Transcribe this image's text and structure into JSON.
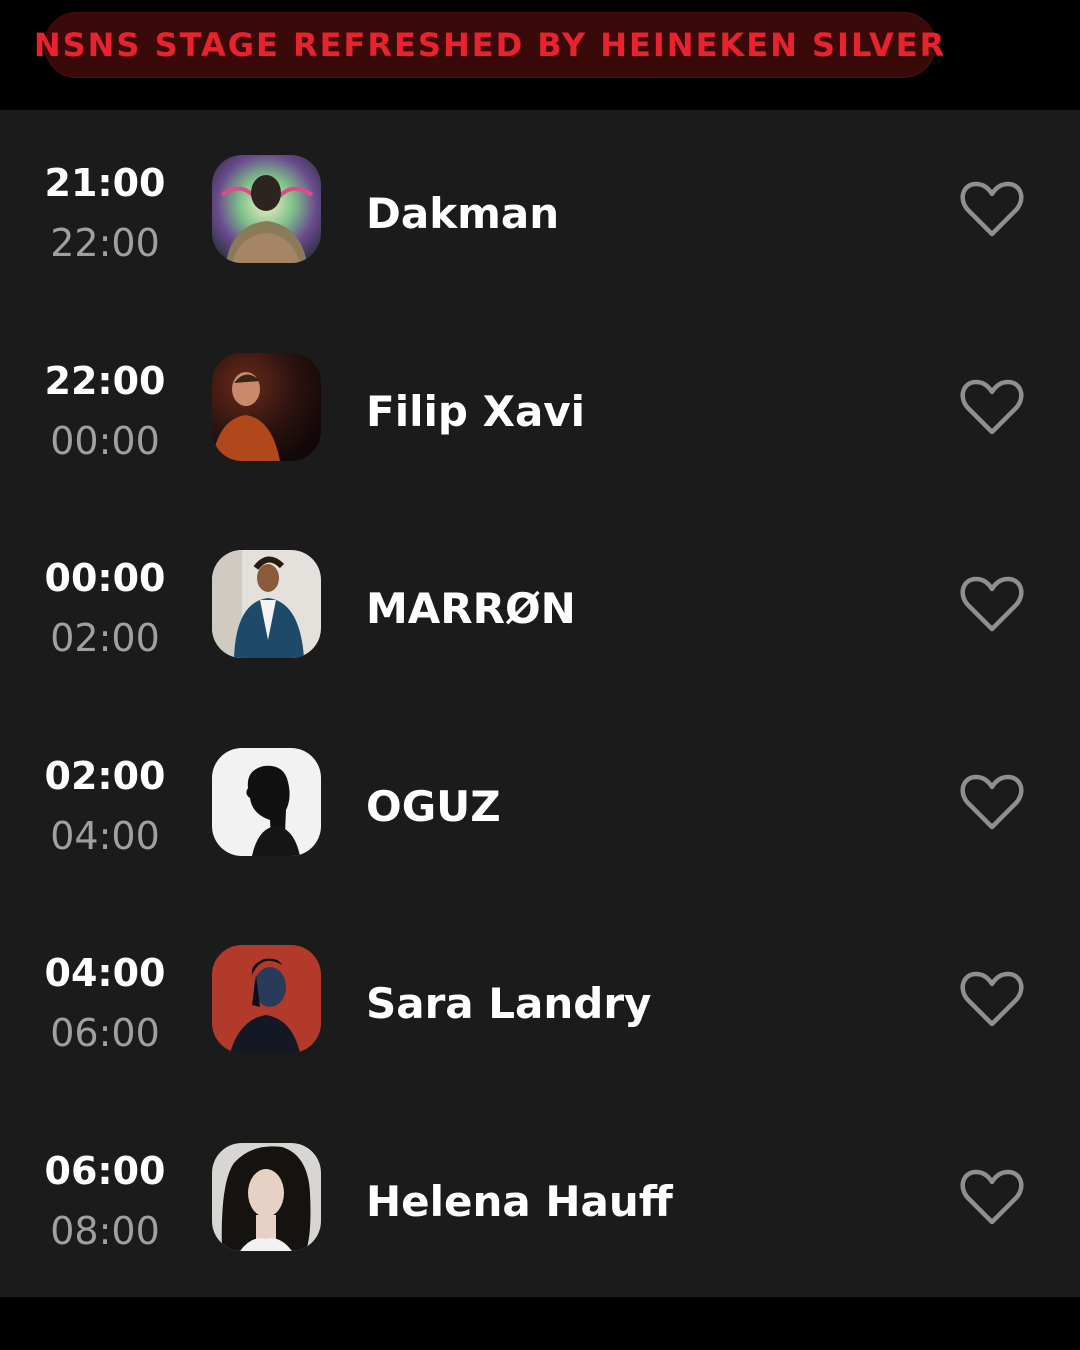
{
  "stage": {
    "title": "NSNS STAGE REFRESHED BY HEINEKEN SILVER",
    "accent_color": "#e8232e",
    "pill_color": "#3a0a0a"
  },
  "lineup": [
    {
      "start": "21:00",
      "end": "22:00",
      "artist": "Dakman",
      "favorite_icon": "heart-outline-icon"
    },
    {
      "start": "22:00",
      "end": "00:00",
      "artist": "Filip Xavi",
      "favorite_icon": "heart-outline-icon"
    },
    {
      "start": "00:00",
      "end": "02:00",
      "artist": "MARRØN",
      "favorite_icon": "heart-outline-icon"
    },
    {
      "start": "02:00",
      "end": "04:00",
      "artist": "OGUZ",
      "favorite_icon": "heart-outline-icon"
    },
    {
      "start": "04:00",
      "end": "06:00",
      "artist": "Sara Landry",
      "favorite_icon": "heart-outline-icon"
    },
    {
      "start": "06:00",
      "end": "08:00",
      "artist": "Helena Hauff",
      "favorite_icon": "heart-outline-icon"
    }
  ]
}
